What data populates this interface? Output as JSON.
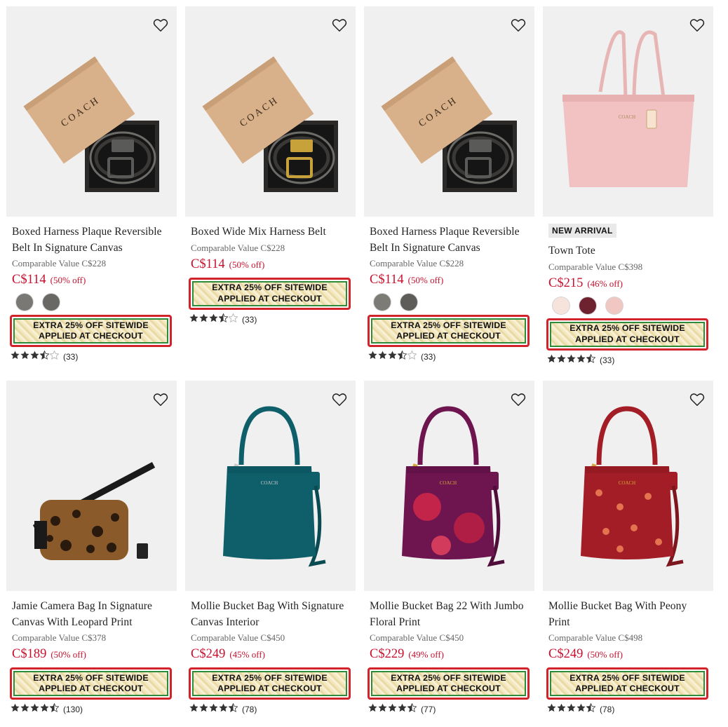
{
  "promo": {
    "line1": "EXTRA 25% OFF SITEWIDE",
    "line2": "APPLIED AT CHECKOUT"
  },
  "products": [
    {
      "name": "Boxed Harness Plaque Reversible Belt In Signature Canvas",
      "comparable": "Comparable Value C$228",
      "price": "C$114",
      "discount": "(50% off)",
      "swatches": [
        "#7a7875",
        "#6a6865"
      ],
      "rating": 3.5,
      "reviews": "(33)",
      "image": "boxed-belt-silver",
      "badge": ""
    },
    {
      "name": "Boxed Wide Mix Harness Belt",
      "comparable": "Comparable Value C$228",
      "price": "C$114",
      "discount": "(50% off)",
      "swatches": [],
      "rating": 3.5,
      "reviews": "(33)",
      "image": "boxed-belt-gold",
      "badge": ""
    },
    {
      "name": "Boxed Harness Plaque Reversible Belt In Signature Canvas",
      "comparable": "Comparable Value C$228",
      "price": "C$114",
      "discount": "(50% off)",
      "swatches": [
        "#7c7b76",
        "#5f5d5a"
      ],
      "rating": 3.5,
      "reviews": "(33)",
      "image": "boxed-belt-silver",
      "badge": ""
    },
    {
      "name": "Town Tote",
      "comparable": "Comparable Value C$398",
      "price": "C$215",
      "discount": "(46% off)",
      "swatches": [
        "#f5e3dc",
        "#6e2230",
        "#f0c7c2"
      ],
      "rating": 4.5,
      "reviews": "(33)",
      "image": "pink-tote",
      "badge": "NEW ARRIVAL"
    },
    {
      "name": "Jamie Camera Bag In Signature Canvas With Leopard Print",
      "comparable": "Comparable Value C$378",
      "price": "C$189",
      "discount": "(50% off)",
      "swatches": [],
      "rating": 4.5,
      "reviews": "(130)",
      "image": "leopard-camera-bag",
      "badge": ""
    },
    {
      "name": "Mollie Bucket Bag With Signature Canvas Interior",
      "comparable": "Comparable Value C$450",
      "price": "C$249",
      "discount": "(45% off)",
      "swatches": [],
      "rating": 4.5,
      "reviews": "(78)",
      "image": "teal-bucket-bag",
      "badge": ""
    },
    {
      "name": "Mollie Bucket Bag 22 With Jumbo Floral Print",
      "comparable": "Comparable Value C$450",
      "price": "C$229",
      "discount": "(49% off)",
      "swatches": [],
      "rating": 4.5,
      "reviews": "(77)",
      "image": "purple-floral-bucket-bag",
      "badge": ""
    },
    {
      "name": "Mollie Bucket Bag With Peony Print",
      "comparable": "Comparable Value C$498",
      "price": "C$249",
      "discount": "(50% off)",
      "swatches": [],
      "rating": 4.5,
      "reviews": "(78)",
      "image": "red-peony-bucket-bag",
      "badge": ""
    }
  ],
  "colors": {
    "price": "#c8102e",
    "promo_border": "#d2232a",
    "promo_inner_border": "#2e8b3a",
    "star": "#333333",
    "star_empty": "#bbbbbb"
  }
}
